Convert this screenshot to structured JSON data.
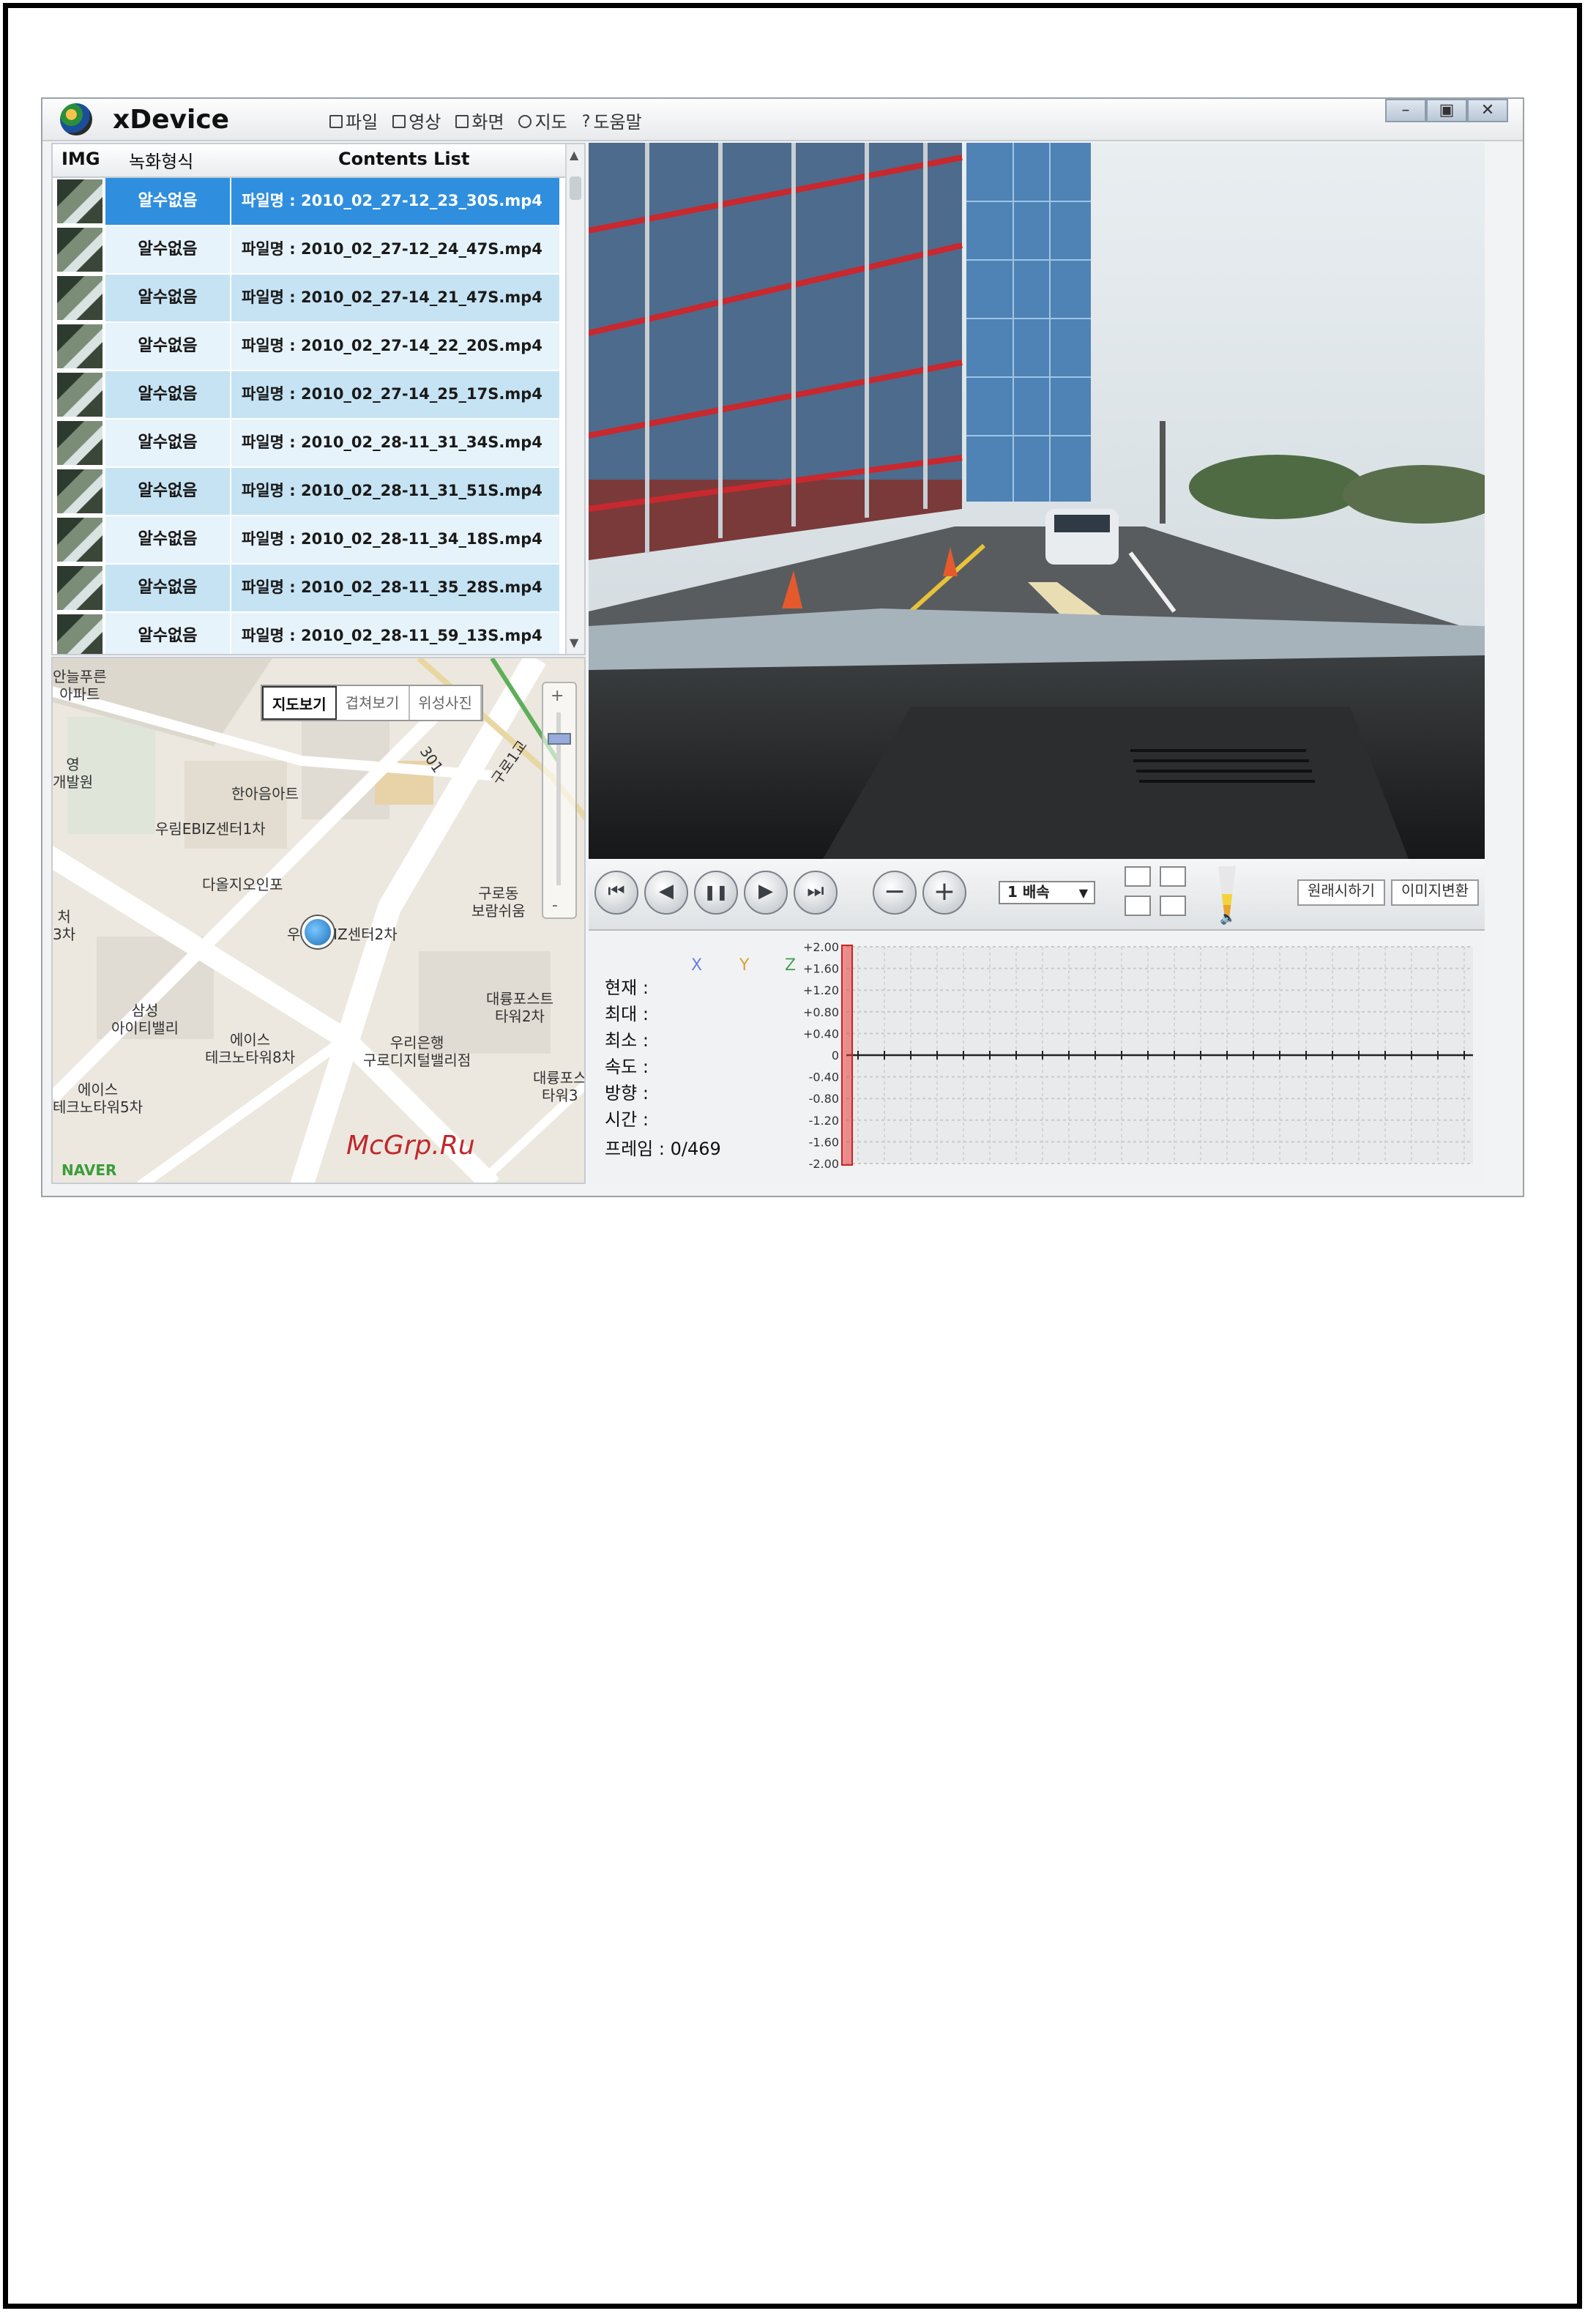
{
  "app": {
    "title": "xDevice",
    "menu": [
      {
        "label": "파일",
        "icon": "save-icon"
      },
      {
        "label": "영상",
        "icon": "video-icon"
      },
      {
        "label": "화면",
        "icon": "monitor-icon"
      },
      {
        "label": "지도",
        "icon": "map-pin-icon"
      },
      {
        "label": "도움말",
        "icon": "help-icon"
      }
    ],
    "window_controls": [
      "–",
      "▣",
      "✕"
    ]
  },
  "content_list": {
    "headers": {
      "img": "IMG",
      "rec": "녹화형식",
      "contents": "Contents List"
    },
    "rows": [
      {
        "rec": "알수없음",
        "file": "파일명 : 2010_02_27-12_23_30S.mp4",
        "selected": true
      },
      {
        "rec": "알수없음",
        "file": "파일명 : 2010_02_27-12_24_47S.mp4",
        "selected": false
      },
      {
        "rec": "알수없음",
        "file": "파일명 : 2010_02_27-14_21_47S.mp4",
        "selected": false
      },
      {
        "rec": "알수없음",
        "file": "파일명 : 2010_02_27-14_22_20S.mp4",
        "selected": false
      },
      {
        "rec": "알수없음",
        "file": "파일명 : 2010_02_27-14_25_17S.mp4",
        "selected": false
      },
      {
        "rec": "알수없음",
        "file": "파일명 : 2010_02_28-11_31_34S.mp4",
        "selected": false
      },
      {
        "rec": "알수없음",
        "file": "파일명 : 2010_02_28-11_31_51S.mp4",
        "selected": false
      },
      {
        "rec": "알수없음",
        "file": "파일명 : 2010_02_28-11_34_18S.mp4",
        "selected": false
      },
      {
        "rec": "알수없음",
        "file": "파일명 : 2010_02_28-11_35_28S.mp4",
        "selected": false
      },
      {
        "rec": "알수없음",
        "file": "파일명 : 2010_02_28-11_59_13S.mp4",
        "selected": false
      }
    ]
  },
  "map": {
    "tabs": [
      "지도보기",
      "겹쳐보기",
      "위성사진"
    ],
    "active_tab": 0,
    "brand": "NAVER",
    "labels": [
      {
        "text": "안늘푸른\n아파트"
      },
      {
        "text": "영\n개발원"
      },
      {
        "text": "한아음아트"
      },
      {
        "text": "우림EBIZ센터1차"
      },
      {
        "text": "다올지오인포"
      },
      {
        "text": "구로동\n보람쉬움"
      },
      {
        "text": "처\n3차"
      },
      {
        "text": "우림EBIZ센터2차"
      },
      {
        "text": "대륭포스트\n타워2차"
      },
      {
        "text": "삼성\n아이티밸리"
      },
      {
        "text": "에이스\n테크노타워8차"
      },
      {
        "text": "우리은행\n구로디지털밸리점"
      },
      {
        "text": "대륭포스\n타워3"
      },
      {
        "text": "에이스\n테크노타워5차"
      },
      {
        "text": "301"
      },
      {
        "text": "구로1교"
      }
    ],
    "zoom": {
      "plus": "+",
      "minus": "-"
    }
  },
  "player": {
    "buttons": [
      {
        "name": "skip-back-button",
        "icon": "skip-back-icon",
        "glyph": "⏮"
      },
      {
        "name": "prev-button",
        "icon": "prev-icon",
        "glyph": "◀"
      },
      {
        "name": "pause-button",
        "icon": "pause-icon",
        "glyph": "❚❚"
      },
      {
        "name": "play-button",
        "icon": "play-icon",
        "glyph": "▶"
      },
      {
        "name": "skip-forward-button",
        "icon": "skip-forward-icon",
        "glyph": "⏭"
      },
      {
        "name": "zoom-out-button",
        "icon": "minus-icon",
        "glyph": "−"
      },
      {
        "name": "zoom-in-button",
        "icon": "plus-icon",
        "glyph": "+"
      }
    ],
    "speed": "1 배속",
    "right_buttons": [
      "원래시하기",
      "이미지변환"
    ]
  },
  "sensor": {
    "axes": [
      {
        "name": "X",
        "color": "#6d7ee0"
      },
      {
        "name": "Y",
        "color": "#e0a030"
      },
      {
        "name": "Z",
        "color": "#4aa05a"
      }
    ],
    "stats": [
      {
        "label": "현재",
        "value": ":"
      },
      {
        "label": "최대",
        "value": ":"
      },
      {
        "label": "최소",
        "value": ":"
      },
      {
        "label": "속도",
        "value": ":"
      },
      {
        "label": "방향",
        "value": ":"
      },
      {
        "label": "시간",
        "value": ":"
      }
    ],
    "frame": "프레임 : 0/469",
    "y_ticks": [
      "+2.00",
      "+1.60",
      "+1.20",
      "+0.80",
      "+0.40",
      "0",
      "-0.40",
      "-0.80",
      "-1.20",
      "-1.60",
      "-2.00"
    ]
  },
  "watermark": "McGrp.Ru"
}
